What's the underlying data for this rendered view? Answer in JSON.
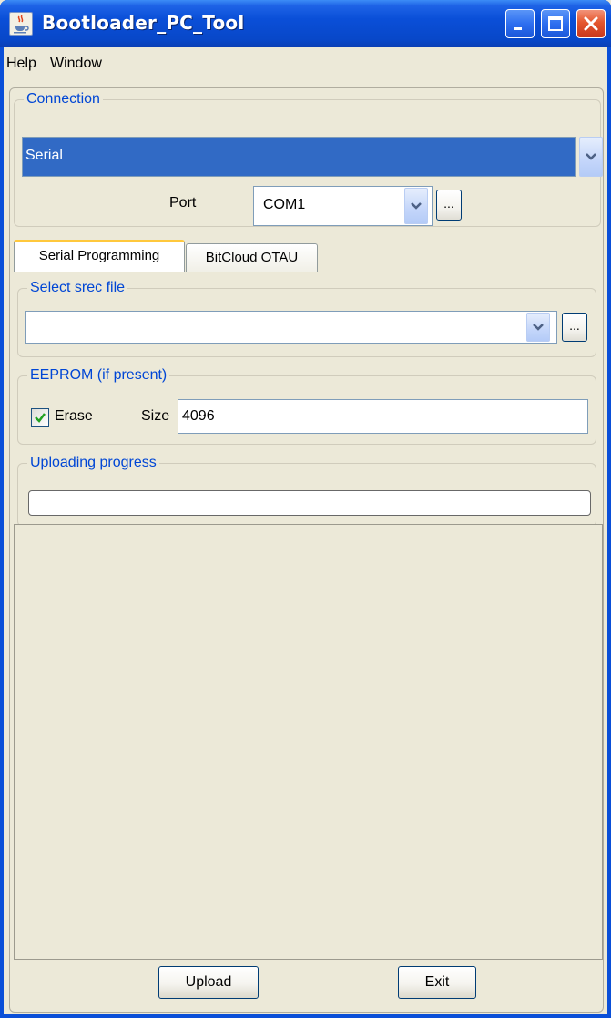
{
  "window": {
    "title": "Bootloader_PC_Tool",
    "app_icon": "java-cup-icon",
    "controls": [
      "minimize-icon",
      "maximize-icon",
      "close-icon"
    ]
  },
  "menu": {
    "items": [
      "Help",
      "Window"
    ]
  },
  "connection": {
    "legend": "Connection",
    "type_value": "Serial",
    "port_label": "Port",
    "port_value": "COM1",
    "browse_label": "..."
  },
  "tabs": [
    {
      "label": "Serial Programming",
      "active": true
    },
    {
      "label": "BitCloud OTAU",
      "active": false
    }
  ],
  "srec": {
    "legend": "Select srec file",
    "value": "",
    "browse_label": "..."
  },
  "eeprom": {
    "legend": "EEPROM (if present)",
    "erase_label": "Erase",
    "erase_checked": true,
    "size_label": "Size",
    "size_value": "4096"
  },
  "progress": {
    "legend": "Uploading progress",
    "value_percent": 0
  },
  "buttons": {
    "upload": "Upload",
    "exit": "Exit"
  },
  "colors": {
    "titlebar": "#0a4fd8",
    "selection": "#316ac5",
    "legend_text": "#0046d5",
    "background": "#ece9d8",
    "tab_highlight": "#ffc83c"
  }
}
